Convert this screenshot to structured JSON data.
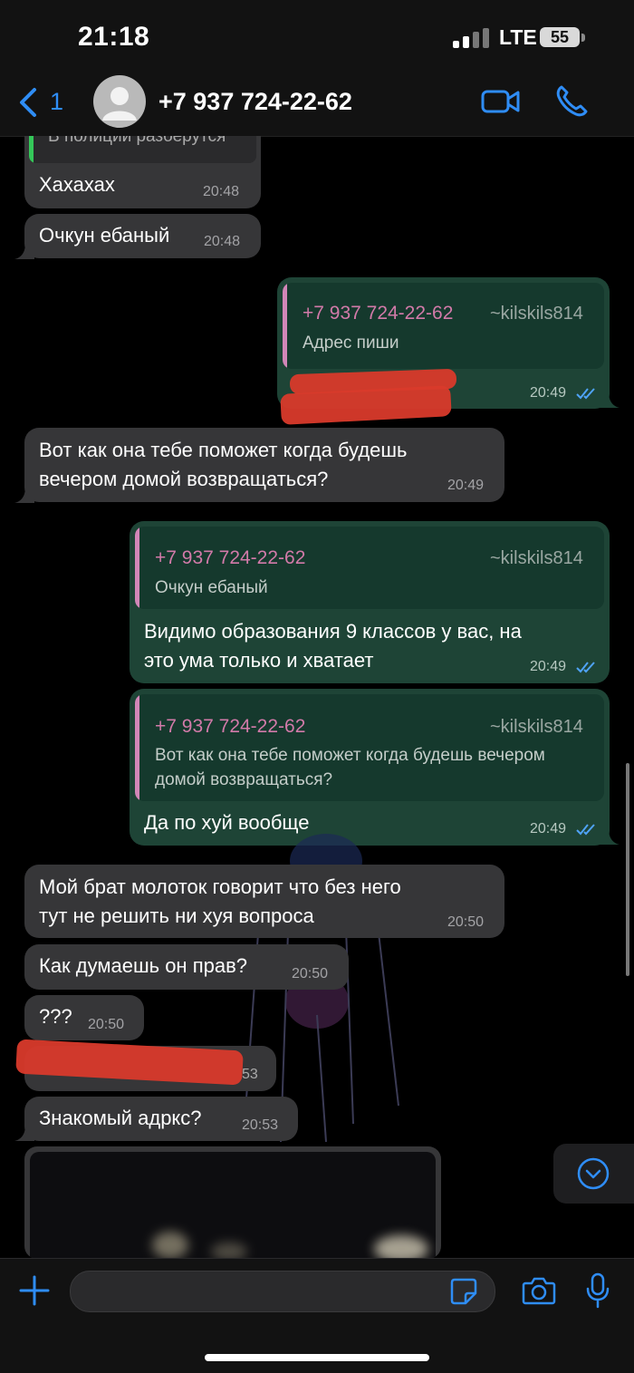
{
  "status": {
    "time": "21:18",
    "network": "LTE",
    "battery": "55"
  },
  "nav": {
    "back_count": "1",
    "contact": "+7 937 724-22-62"
  },
  "messages": {
    "m1": {
      "quote": "В полиции разберутся",
      "text": "Хахахах",
      "time": "20:48"
    },
    "m2": {
      "text": "Очкун ебаный",
      "time": "20:48"
    },
    "m3": {
      "reply_name": "+7 937 724-22-62",
      "reply_user": "~kilskils814",
      "reply_text": "Адрес пиши",
      "time": "20:49"
    },
    "m4": {
      "line1": "Вот как она тебе поможет когда будешь",
      "line2": "вечером домой возвращаться?",
      "time": "20:49"
    },
    "m5": {
      "reply_name": "+7 937 724-22-62",
      "reply_user": "~kilskils814",
      "reply_text": "Очкун ебаный",
      "line1": "Видимо образования 9 классов у вас, на",
      "line2": "это ума только и хватает",
      "time": "20:49"
    },
    "m6": {
      "reply_name": "+7 937 724-22-62",
      "reply_user": "~kilskils814",
      "reply_line1": "Вот как она тебе поможет когда будешь вечером",
      "reply_line2": "домой возвращаться?",
      "text": "Да по хуй вообще",
      "time": "20:49"
    },
    "m7": {
      "line1": "Мой брат молоток говорит что без него",
      "line2": "тут не решить ни хуя вопроса",
      "time": "20:50"
    },
    "m8": {
      "text": "Как думаешь он прав?",
      "time": "20:50"
    },
    "m9": {
      "text": "???",
      "time": "20:50"
    },
    "m10": {
      "time_partial": "53"
    },
    "m11": {
      "text": "Знакомый адркс?",
      "time": "20:53"
    }
  },
  "colors": {
    "accent": "#2f8df6",
    "incoming": "#363638",
    "outgoing": "#1e4436",
    "quote_name": "#d27aa9",
    "redaction": "#d93a2b"
  }
}
